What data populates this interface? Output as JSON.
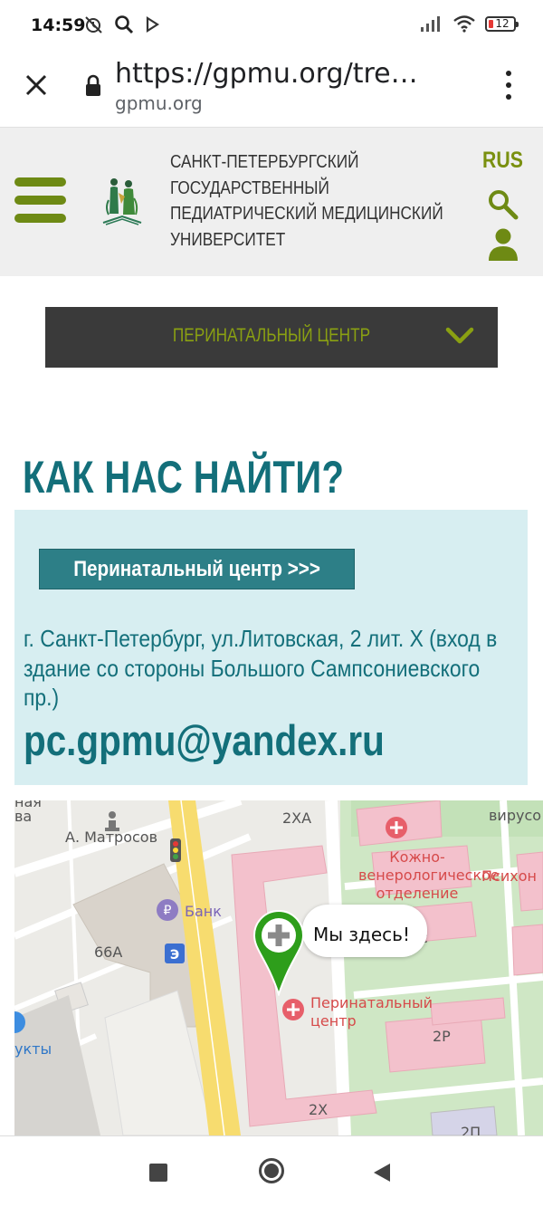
{
  "status_bar": {
    "time": "14:59",
    "icons": [
      "alarm-off-icon",
      "search-icon",
      "play-store-icon",
      "signal-icon",
      "wifi-icon"
    ],
    "battery": "12"
  },
  "browser": {
    "url": "https://gpmu.org/tre…",
    "domain": "gpmu.org"
  },
  "site_header": {
    "university_name_lines": [
      "САНКТ-ПЕТЕРБУРГСКИЙ",
      "ГОСУДАРСТВЕННЫЙ",
      "ПЕДИАТРИЧЕСКИЙ МЕДИЦИНСКИЙ",
      "УНИВЕРСИТЕТ"
    ],
    "language": "RUS",
    "accent_color": "#6e8a14"
  },
  "dropdown": {
    "label": "ПЕРИНАТАЛЬНЫЙ ЦЕНТР"
  },
  "main": {
    "title": "КАК НАС НАЙТИ?",
    "center_button": "Перинатальный центр >>>",
    "address": "г. Санкт-Петербург, ул.Литовская, 2 лит. Х (вход в здание со стороны Большого Сампсониевского пр.)",
    "email": "pc.gpmu@yandex.ru",
    "title_color": "#136f7a"
  },
  "map": {
    "labels": {
      "top_left_1": "ная",
      "top_left_2": "ва",
      "matrosov": "А. Матросов",
      "bank": "Банк",
      "building_66a": "66А",
      "products": "укты",
      "building_2xa": "2ХА",
      "virus": "вирусо",
      "skin_clinic": "Кожно-\nвенерологическое\nотделение",
      "psycho": "Психон",
      "partial_c": "с",
      "perinatal": "Перинатальный\nцентр",
      "building_2r": "2Р",
      "building_2x": "2Х",
      "building_2p": "2П"
    },
    "marker_label": "Мы здесь!"
  }
}
